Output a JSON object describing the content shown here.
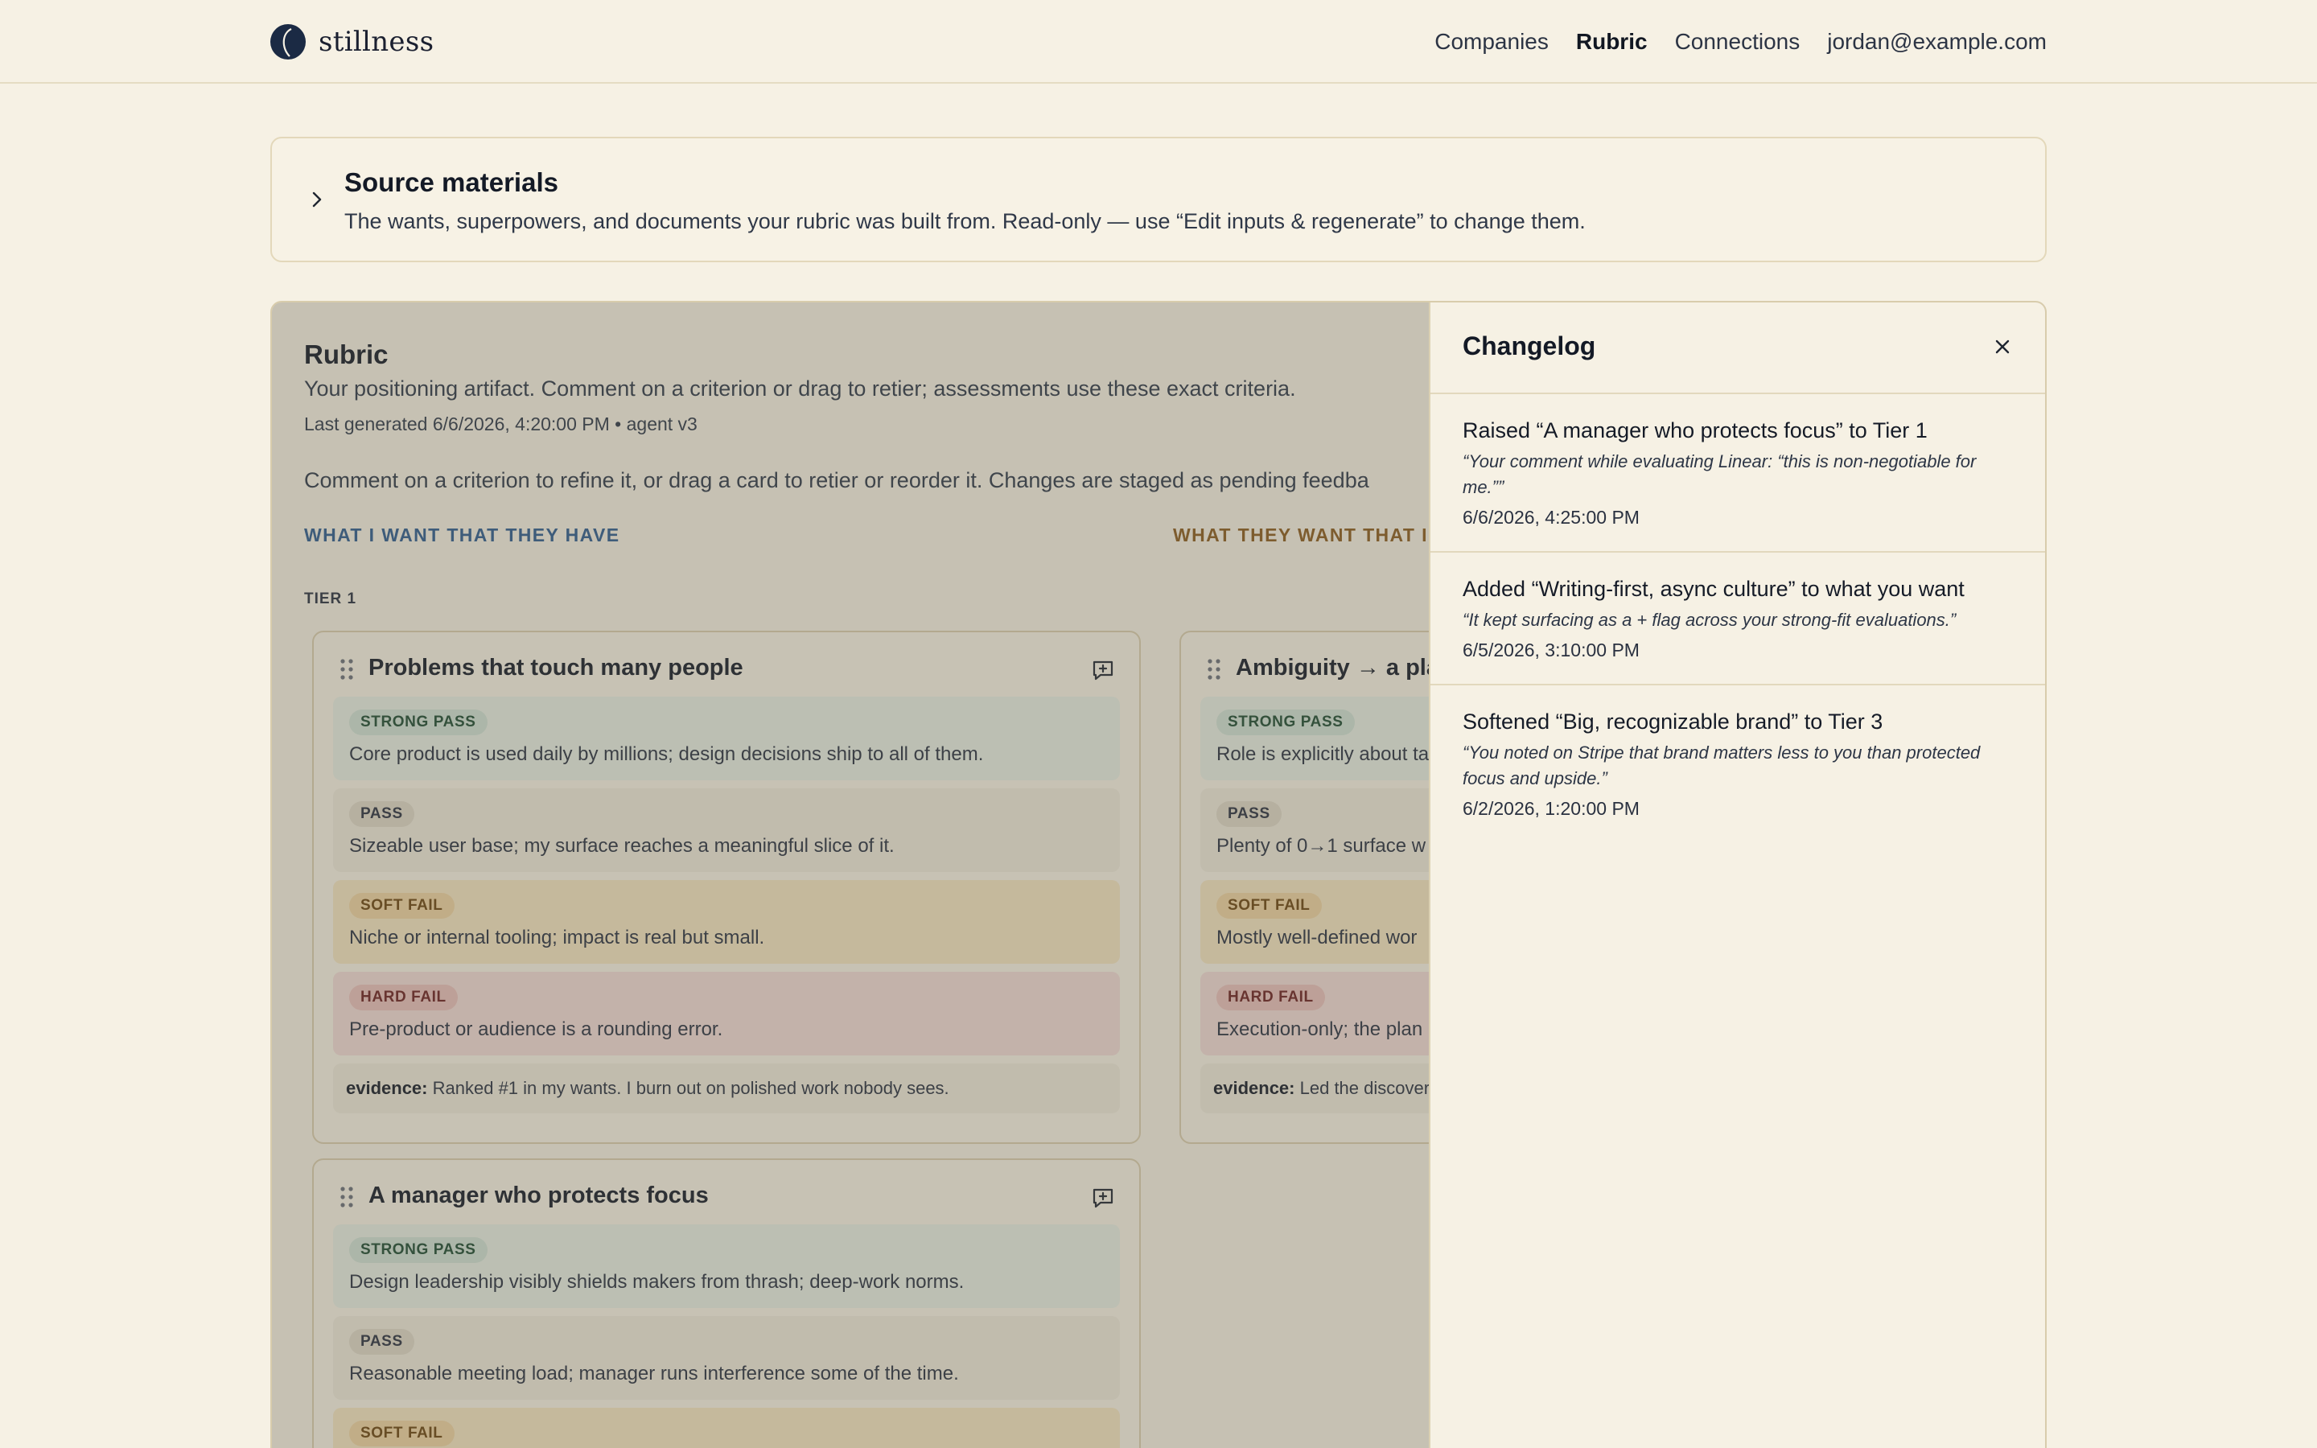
{
  "brand": {
    "name": "stillness"
  },
  "nav": {
    "companies": "Companies",
    "rubric": "Rubric",
    "connections": "Connections",
    "account": "jordan@example.com"
  },
  "source": {
    "title": "Source materials",
    "description": "The wants, superpowers, and documents your rubric was built from. Read-only — use “Edit inputs & regenerate” to change them."
  },
  "rubric": {
    "title": "Rubric",
    "subtitle": "Your positioning artifact. Comment on a criterion or drag to retier; assessments use these exact criteria.",
    "meta": "Last generated 6/6/2026, 4:20:00 PM • agent v3",
    "hint": "Comment on a criterion to refine it, or drag a card to retier or reorder it. Changes are staged as pending feedba",
    "col_left": "WHAT I WANT THAT THEY HAVE",
    "col_right": "WHAT THEY WANT THAT I",
    "tier1_label": "TIER 1",
    "cards": [
      {
        "name": "Problems that touch many people",
        "levels": [
          {
            "badge": "STRONG PASS",
            "text": "Core product is used daily by millions; design decisions ship to all of them."
          },
          {
            "badge": "PASS",
            "text": "Sizeable user base; my surface reaches a meaningful slice of it."
          },
          {
            "badge": "SOFT FAIL",
            "text": "Niche or internal tooling; impact is real but small."
          },
          {
            "badge": "HARD FAIL",
            "text": "Pre-product or audience is a rounding error."
          }
        ],
        "evidence_label": "evidence:",
        "evidence": "Ranked #1 in my wants. I burn out on polished work nobody sees."
      },
      {
        "name": "Ambiguity → a plan",
        "levels": [
          {
            "badge": "STRONG PASS",
            "text": "Role is explicitly about ta"
          },
          {
            "badge": "PASS",
            "text": "Plenty of 0→1 surface w"
          },
          {
            "badge": "SOFT FAIL",
            "text": "Mostly well-defined wor"
          },
          {
            "badge": "HARD FAIL",
            "text": "Execution-only; the plan"
          }
        ],
        "evidence_label": "evidence:",
        "evidence": "Led the discover"
      },
      {
        "name": "A manager who protects focus",
        "levels": [
          {
            "badge": "STRONG PASS",
            "text": "Design leadership visibly shields makers from thrash; deep-work norms."
          },
          {
            "badge": "PASS",
            "text": "Reasonable meeting load; manager runs interference some of the time."
          },
          {
            "badge": "SOFT FAIL",
            "text": ""
          }
        ]
      }
    ]
  },
  "changelog": {
    "title": "Changelog",
    "items": [
      {
        "title": "Raised “A manager who protects focus” to Tier 1",
        "quote": "“Your comment while evaluating Linear: “this is non-negotiable for me.””",
        "date": "6/6/2026, 4:25:00 PM"
      },
      {
        "title": "Added “Writing-first, async culture” to what you want",
        "quote": "“It kept surfacing as a + flag across your strong-fit evaluations.”",
        "date": "6/5/2026, 3:10:00 PM"
      },
      {
        "title": "Softened “Big, recognizable brand” to Tier 3",
        "quote": "“You noted on Stripe that brand matters less to you than protected focus and upside.”",
        "date": "6/2/2026, 1:20:00 PM"
      }
    ]
  },
  "colors": {
    "background": "#f6f1e4",
    "accent_blue": "#2d5a8c",
    "accent_amber": "#8a5a1c",
    "logo": "#1b2a44"
  },
  "icons": [
    "logo-icon",
    "chevron-right-icon",
    "drag-handle-icon",
    "comment-add-icon",
    "close-icon"
  ]
}
